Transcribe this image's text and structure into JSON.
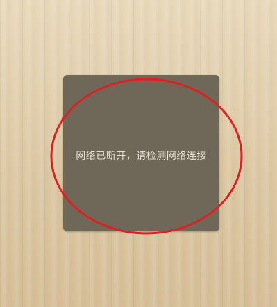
{
  "background": {
    "base_color": "#dcc7a2"
  },
  "dialog": {
    "message": "网络已断开，请检测网络连接",
    "background_color": "#6f6757",
    "text_color": "#e5dfd3"
  },
  "annotation": {
    "shape": "ellipse",
    "stroke_color": "#e02020"
  }
}
